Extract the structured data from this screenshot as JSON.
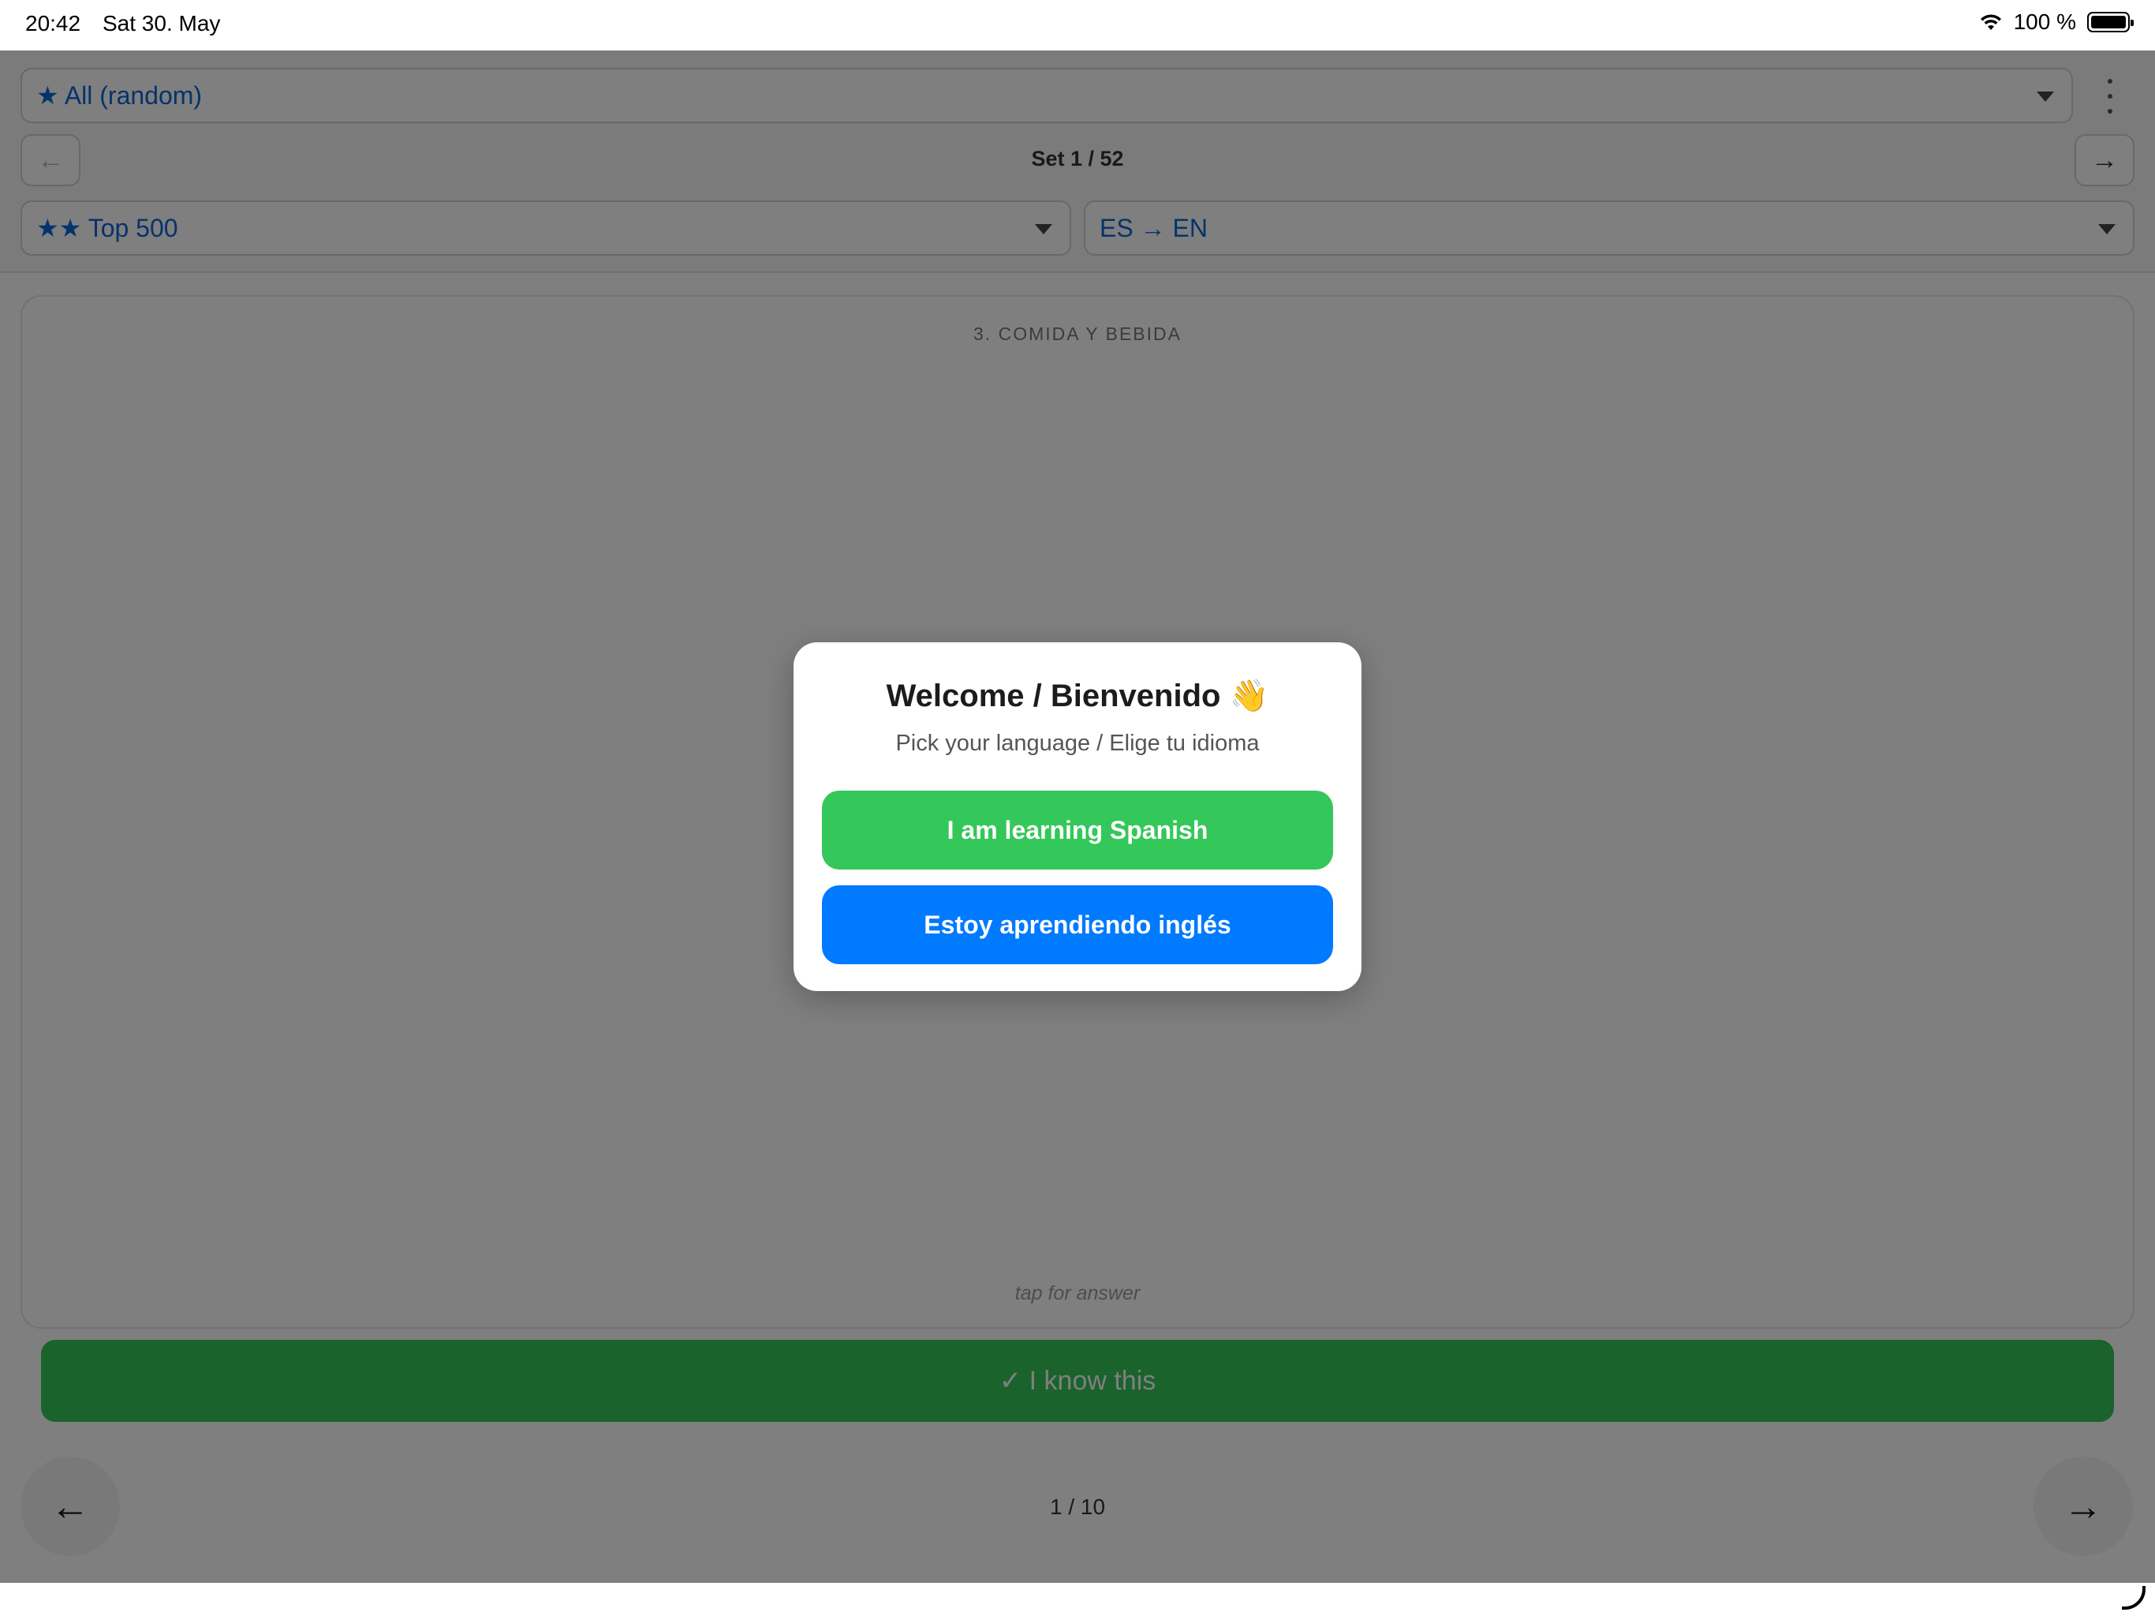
{
  "status_bar": {
    "time": "20:42",
    "date": "Sat 30. May",
    "battery_percent": "100 %"
  },
  "header": {
    "deck_select_value": "★ All (random)",
    "set_label": "Set 1 / 52",
    "set_prev_icon": "←",
    "set_next_icon": "→",
    "level_select_value": "★★ Top 500",
    "direction_select_value": "ES → EN",
    "more_icon": "kebab-menu-icon"
  },
  "card": {
    "category": "3. COMIDA Y BEBIDA",
    "hint": "tap for answer"
  },
  "actions": {
    "know_label": "✓ I know this",
    "prev_icon": "←",
    "next_icon": "→",
    "progress": "1 / 10"
  },
  "modal": {
    "title": "Welcome / Bienvenido 👋",
    "subtitle": "Pick your language / Elige tu idioma",
    "spanish_button": "I am learning Spanish",
    "english_button": "Estoy aprendiendo inglés"
  },
  "colors": {
    "accent_blue": "#007aff",
    "accent_green": "#34c759",
    "link_blue": "#0a66d6"
  }
}
